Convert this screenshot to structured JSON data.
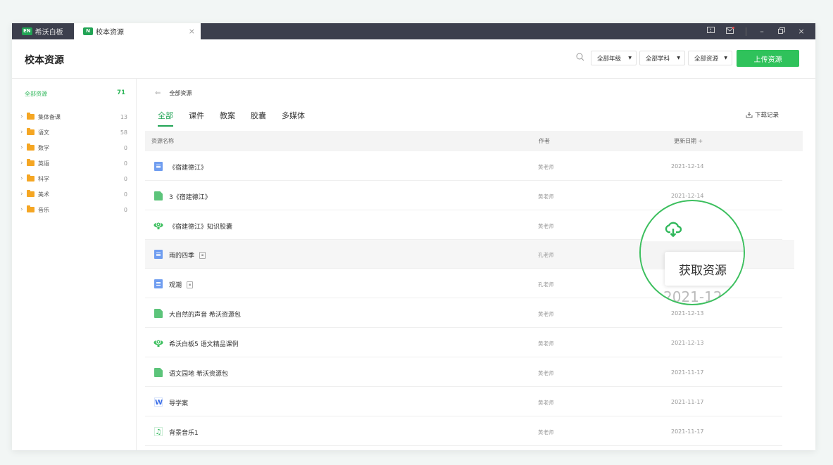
{
  "titlebar": {
    "app_tab": {
      "logo": "EN",
      "label": "希沃白板"
    },
    "active_tab": {
      "logo": "N",
      "label": "校本资源",
      "close": "×"
    }
  },
  "header": {
    "title": "校本资源",
    "filters": [
      {
        "label": "全部年级"
      },
      {
        "label": "全部学科"
      },
      {
        "label": "全部资源"
      }
    ],
    "upload_label": "上传资源"
  },
  "sidebar": {
    "all_label": "全部资源",
    "all_count": "71",
    "folders": [
      {
        "label": "集体备课",
        "count": "13"
      },
      {
        "label": "语文",
        "count": "58"
      },
      {
        "label": "数学",
        "count": "0"
      },
      {
        "label": "英语",
        "count": "0"
      },
      {
        "label": "科学",
        "count": "0"
      },
      {
        "label": "美术",
        "count": "0"
      },
      {
        "label": "音乐",
        "count": "0"
      }
    ]
  },
  "main": {
    "breadcrumb": "全部资源",
    "tabs": [
      "全部",
      "课件",
      "教案",
      "胶囊",
      "多媒体"
    ],
    "download_record": "下载记录",
    "columns": {
      "name": "资源名称",
      "author": "作者",
      "date": "更新日期 ÷"
    },
    "rows": [
      {
        "icon": "doc-icon",
        "name": "《宿建德江》",
        "author": "黄老师",
        "date": "2021-12-14"
      },
      {
        "icon": "file-icon",
        "name": "3《宿建德江》",
        "author": "黄老师",
        "date": "2021-12-14"
      },
      {
        "icon": "capsule-icon",
        "name": "《宿建德江》知识胶囊",
        "author": "黄老师",
        "date": ""
      },
      {
        "icon": "doc-icon",
        "name": "雨的四季",
        "author": "孔老师",
        "date": ""
      },
      {
        "icon": "doc-icon",
        "name": "观潮",
        "author": "孔老师",
        "date": ""
      },
      {
        "icon": "file-icon",
        "name": "大自然的声音 希沃资源包",
        "author": "黄老师",
        "date": "2021-12-13"
      },
      {
        "icon": "capsule-icon",
        "name": "希沃白板5 语文精品课例",
        "author": "黄老师",
        "date": "2021-12-13"
      },
      {
        "icon": "file-icon",
        "name": "语文园地 希沃资源包",
        "author": "黄老师",
        "date": "2021-11-17"
      },
      {
        "icon": "word-icon",
        "name": "导学案",
        "author": "黄老师",
        "date": "2021-11-17"
      },
      {
        "icon": "music-icon",
        "name": "背景音乐1",
        "author": "黄老师",
        "date": "2021-11-17"
      }
    ]
  },
  "magnifier": {
    "tooltip": "获取资源",
    "date_fragment": "2021-12"
  },
  "colors": {
    "accent": "#22a455",
    "button": "#2fc25b",
    "titlebar": "#3c3f4d"
  }
}
